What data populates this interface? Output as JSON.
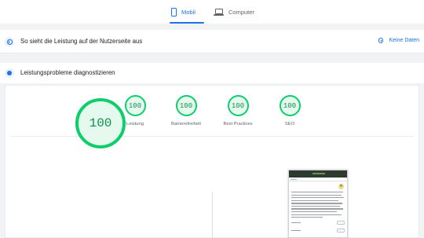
{
  "tabs": {
    "mobile_label": "Mobil",
    "desktop_label": "Computer",
    "active": "Mobil"
  },
  "field_section": {
    "title": "So sieht die Leistung auf der Nutzerseite aus",
    "no_data_label": "Keine Daten"
  },
  "lab_section": {
    "title": "Leistungsprobleme diagnostizieren"
  },
  "categories": [
    {
      "label": "Leistung",
      "score": "100"
    },
    {
      "label": "Barrierefreiheit",
      "score": "100"
    },
    {
      "label": "Best Practices",
      "score": "100"
    },
    {
      "label": "SEO",
      "score": "100"
    }
  ],
  "performance": {
    "score": "100"
  },
  "colors": {
    "accent": "#1a73e8",
    "pass": "#0cce6b",
    "pass_text": "#0d904f",
    "pass_fill": "#e6f9ee"
  },
  "icons": {
    "mobile_tab": "phone-icon",
    "desktop_tab": "laptop-icon",
    "field_section": "info-icon",
    "lab_section": "speed-icon",
    "no_data": "info-icon"
  }
}
